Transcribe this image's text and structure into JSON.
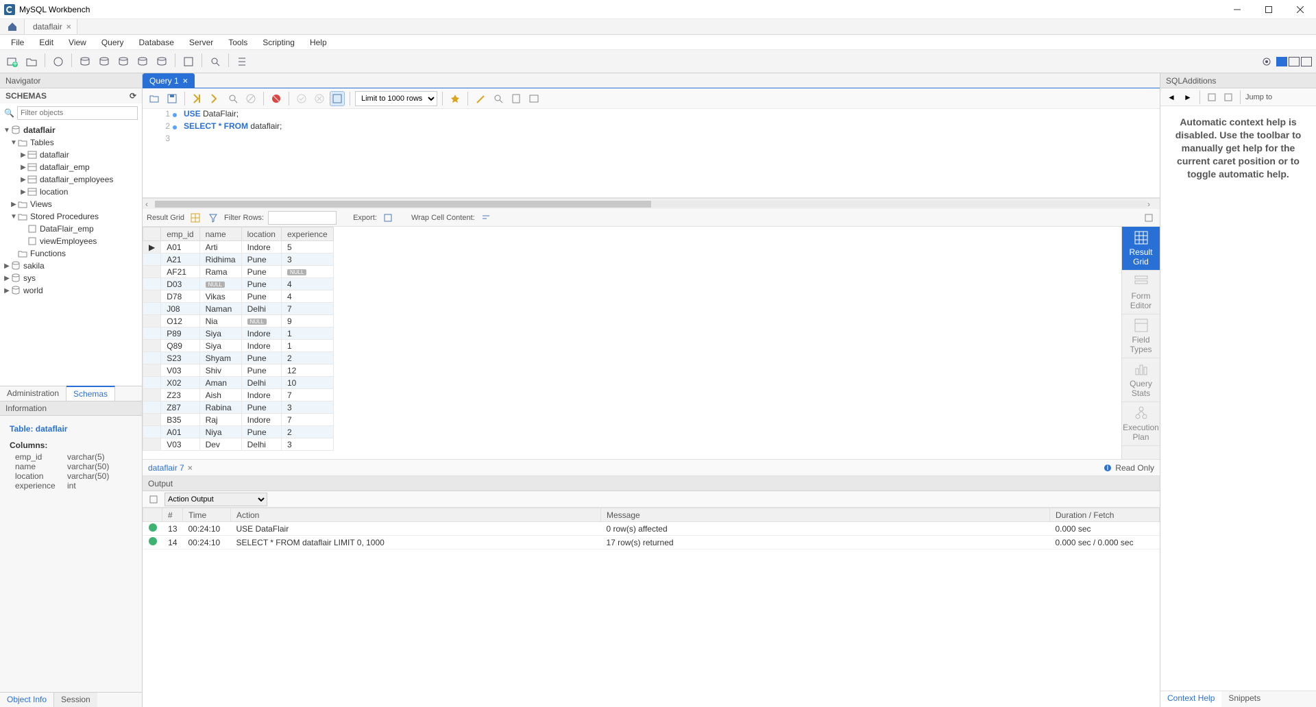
{
  "app_title": "MySQL Workbench",
  "connection_tab": "dataflair",
  "menus": [
    "File",
    "Edit",
    "View",
    "Query",
    "Database",
    "Server",
    "Tools",
    "Scripting",
    "Help"
  ],
  "navigator": {
    "title": "Navigator",
    "schemas_label": "SCHEMAS",
    "filter_placeholder": "Filter objects",
    "active_schema": "dataflair",
    "folders": {
      "tables": "Tables",
      "views": "Views",
      "sp": "Stored Procedures",
      "functions": "Functions"
    },
    "tables": [
      "dataflair",
      "dataflair_emp",
      "dataflair_employees",
      "location"
    ],
    "stored_procs": [
      "DataFlair_emp",
      "viewEmployees"
    ],
    "other_schemas": [
      "sakila",
      "sys",
      "world"
    ],
    "bottom_tabs": {
      "admin": "Administration",
      "schemas": "Schemas"
    }
  },
  "information": {
    "title": "Information",
    "table_label": "Table:",
    "table_name": "dataflair",
    "columns_label": "Columns:",
    "columns": [
      {
        "name": "emp_id",
        "type": "varchar(5)"
      },
      {
        "name": "name",
        "type": "varchar(50)"
      },
      {
        "name": "location",
        "type": "varchar(50)"
      },
      {
        "name": "experience",
        "type": "int"
      }
    ],
    "bottom_tabs": {
      "obj": "Object Info",
      "session": "Session"
    }
  },
  "query": {
    "tab_label": "Query 1",
    "limit_label": "Limit to 1000 rows",
    "lines": [
      {
        "num": "1",
        "prefix": "USE ",
        "mid": "DataFlair;",
        "dot": true
      },
      {
        "num": "2",
        "prefix": "SELECT * FROM ",
        "mid": "dataflair;",
        "dot": true
      },
      {
        "num": "3",
        "prefix": "",
        "mid": "",
        "dot": false
      }
    ]
  },
  "result_bar": {
    "grid_label": "Result Grid",
    "filter_label": "Filter Rows:",
    "export_label": "Export:",
    "wrap_label": "Wrap Cell Content:"
  },
  "result": {
    "columns": [
      "emp_id",
      "name",
      "location",
      "experience"
    ],
    "rows": [
      [
        "A01",
        "Arti",
        "Indore",
        "5"
      ],
      [
        "A21",
        "Ridhima",
        "Pune",
        "3"
      ],
      [
        "AF21",
        "Rama",
        "Pune",
        "NULL"
      ],
      [
        "D03",
        "NULL",
        "Pune",
        "4"
      ],
      [
        "D78",
        "Vikas",
        "Pune",
        "4"
      ],
      [
        "J08",
        "Naman",
        "Delhi",
        "7"
      ],
      [
        "O12",
        "Nia",
        "NULL",
        "9"
      ],
      [
        "P89",
        "Siya",
        "Indore",
        "1"
      ],
      [
        "Q89",
        "Siya",
        "Indore",
        "1"
      ],
      [
        "S23",
        "Shyam",
        "Pune",
        "2"
      ],
      [
        "V03",
        "Shiv",
        "Pune",
        "12"
      ],
      [
        "X02",
        "Aman",
        "Delhi",
        "10"
      ],
      [
        "Z23",
        "Aish",
        "Indore",
        "7"
      ],
      [
        "Z87",
        "Rabina",
        "Pune",
        "3"
      ],
      [
        "B35",
        "Raj",
        "Indore",
        "7"
      ],
      [
        "A01",
        "Niya",
        "Pune",
        "2"
      ],
      [
        "V03",
        "Dev",
        "Delhi",
        "3"
      ]
    ]
  },
  "view_strip": [
    "Result Grid",
    "Form Editor",
    "Field Types",
    "Query Stats",
    "Execution Plan"
  ],
  "result_tab": {
    "label": "dataflair 7",
    "readonly": "Read Only"
  },
  "output": {
    "title": "Output",
    "selector": "Action Output",
    "headers": [
      "",
      "#",
      "Time",
      "Action",
      "Message",
      "Duration / Fetch"
    ],
    "rows": [
      {
        "num": "13",
        "time": "00:24:10",
        "action": "USE DataFlair",
        "message": "0 row(s) affected",
        "dur": "0.000 sec"
      },
      {
        "num": "14",
        "time": "00:24:10",
        "action": "SELECT * FROM dataflair LIMIT 0, 1000",
        "message": "17 row(s) returned",
        "dur": "0.000 sec / 0.000 sec"
      }
    ]
  },
  "right": {
    "title": "SQLAdditions",
    "jump": "Jump to",
    "help_text": "Automatic context help is disabled. Use the toolbar to manually get help for the current caret position or to toggle automatic help.",
    "tabs": {
      "ctx": "Context Help",
      "snip": "Snippets"
    }
  }
}
